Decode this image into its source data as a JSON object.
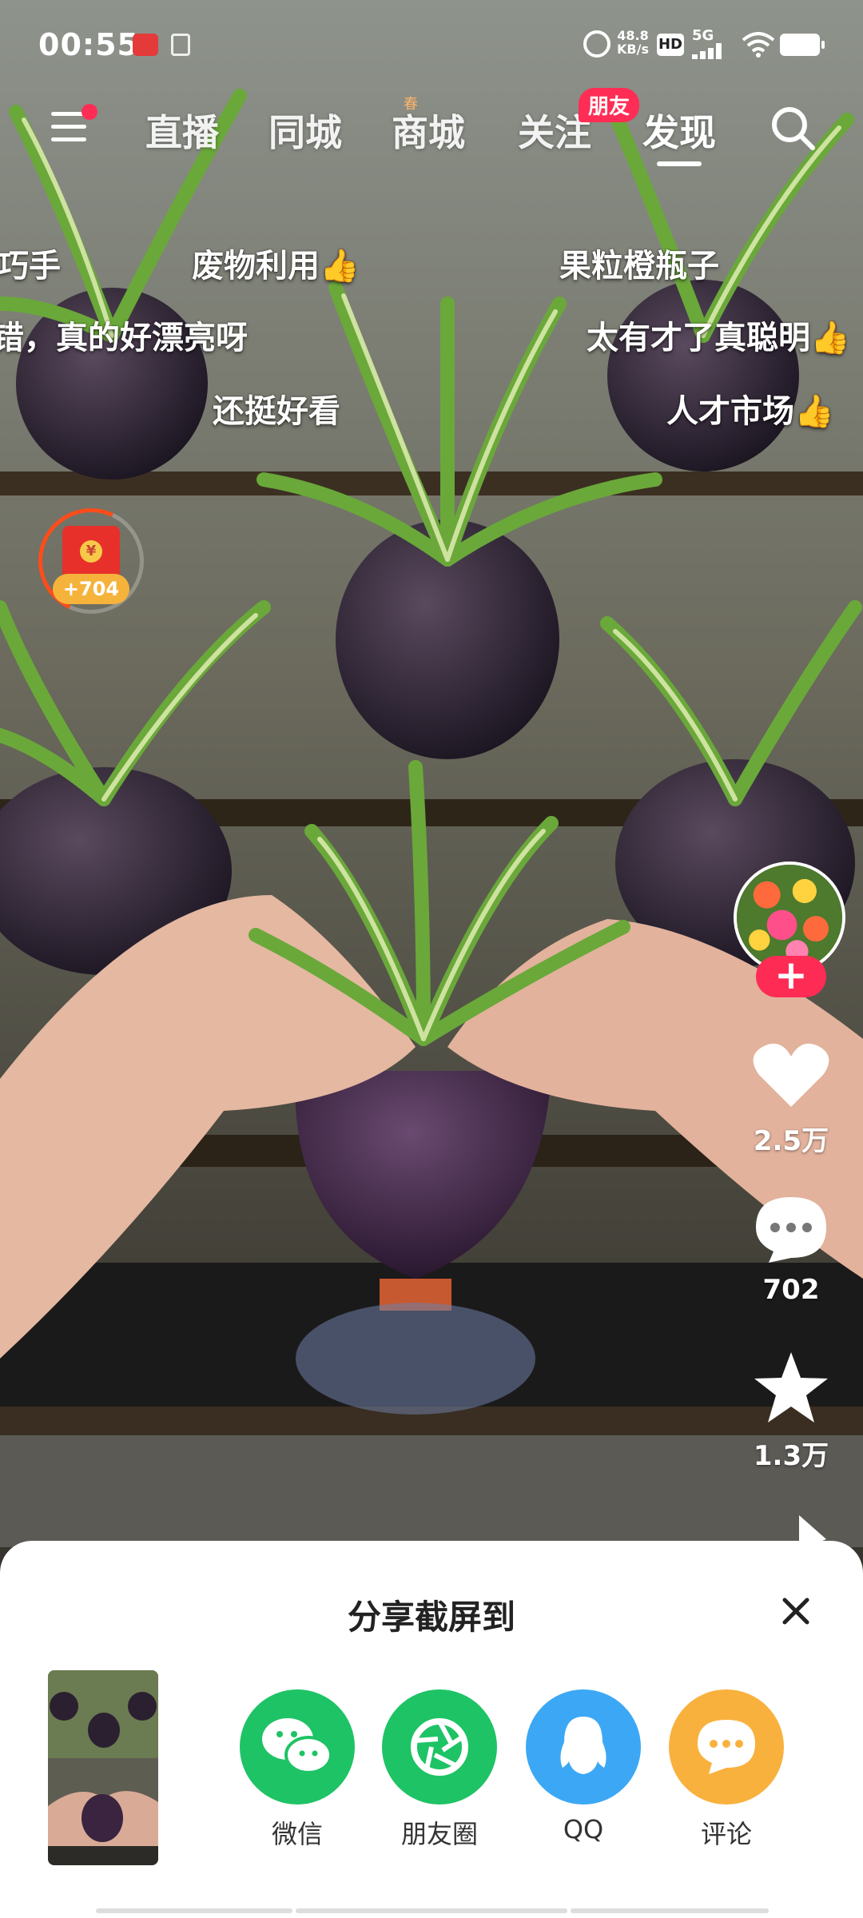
{
  "status_bar": {
    "time": "00:55",
    "net_speed_value": "48.8",
    "net_speed_unit": "KB/s",
    "hd_label": "HD",
    "network_label": "5G"
  },
  "nav": {
    "tabs": [
      {
        "label": "直播"
      },
      {
        "label": "同城"
      },
      {
        "label": "商城"
      },
      {
        "label": "关注"
      },
      {
        "label": "发现"
      }
    ],
    "active_tab": "发现",
    "follow_badge": "朋友",
    "shop_mark": "春"
  },
  "danmaku": [
    "巧手",
    "废物利用👍",
    "果粒橙瓶子",
    "错，真的好漂亮呀",
    "太有才了真聪明👍",
    "还挺好看",
    "人才市场👍"
  ],
  "red_packet": {
    "count": "+704",
    "coin_symbol": "¥"
  },
  "actions": {
    "likes": "2.5万",
    "comments": "702",
    "favorites": "1.3万"
  },
  "share_sheet": {
    "title": "分享截屏到",
    "targets": [
      {
        "label": "微信",
        "icon": "wechat-icon",
        "color": "#1ec365"
      },
      {
        "label": "朋友圈",
        "icon": "moments-icon",
        "color": "#1ec365"
      },
      {
        "label": "QQ",
        "icon": "qq-icon",
        "color": "#3ca8f5"
      },
      {
        "label": "评论",
        "icon": "comment-icon",
        "color": "#f9b13e"
      }
    ]
  },
  "colors": {
    "accent_red": "#fe2c55",
    "badge_red": "#ff2d55",
    "red_packet": "#e8302b",
    "red_packet_pill": "#f5b33b"
  }
}
